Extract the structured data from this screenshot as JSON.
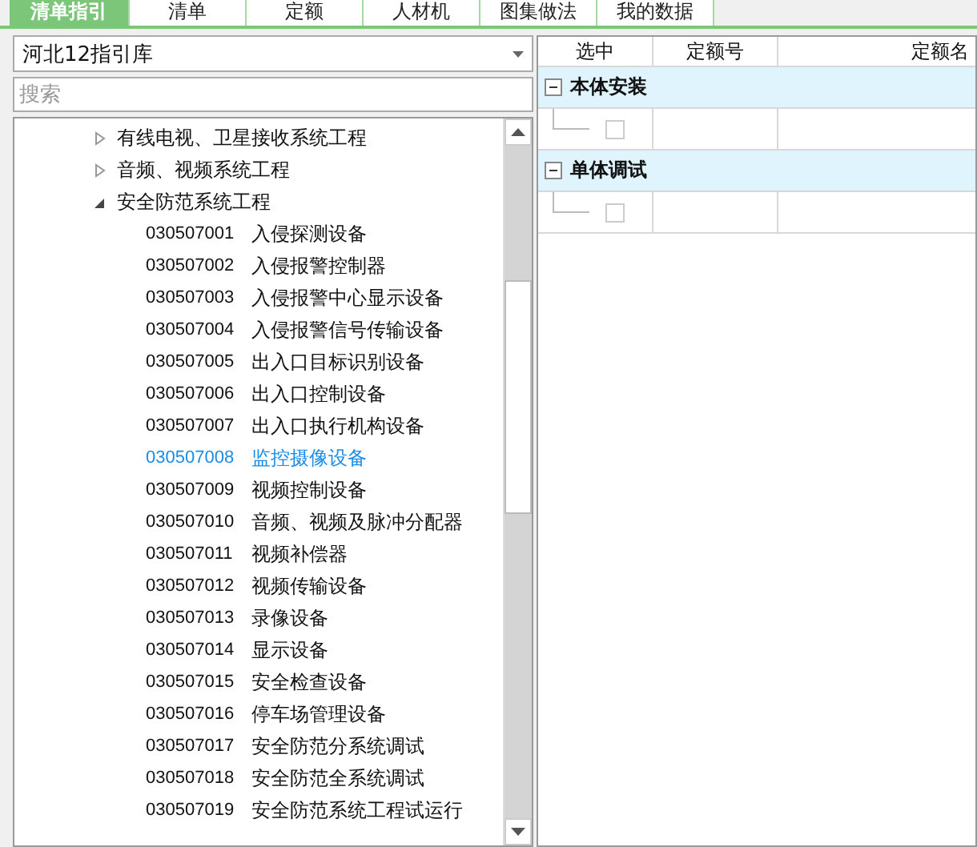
{
  "tabs": [
    {
      "label": "清单指引",
      "selected": true
    },
    {
      "label": "清单",
      "selected": false
    },
    {
      "label": "定额",
      "selected": false
    },
    {
      "label": "人材机",
      "selected": false
    },
    {
      "label": "图集做法",
      "selected": false
    },
    {
      "label": "我的数据",
      "selected": false
    }
  ],
  "library_select": {
    "value": "河北12指引库"
  },
  "search": {
    "placeholder": "搜索"
  },
  "tree": [
    {
      "label": "有线电视、卫星接收系统工程",
      "expanded": false
    },
    {
      "label": "音频、视频系统工程",
      "expanded": false
    },
    {
      "label": "安全防范系统工程",
      "expanded": true,
      "children": [
        {
          "code": "030507001",
          "name": "入侵探测设备",
          "selected": false
        },
        {
          "code": "030507002",
          "name": "入侵报警控制器",
          "selected": false
        },
        {
          "code": "030507003",
          "name": "入侵报警中心显示设备",
          "selected": false
        },
        {
          "code": "030507004",
          "name": "入侵报警信号传输设备",
          "selected": false
        },
        {
          "code": "030507005",
          "name": "出入口目标识别设备",
          "selected": false
        },
        {
          "code": "030507006",
          "name": "出入口控制设备",
          "selected": false
        },
        {
          "code": "030507007",
          "name": "出入口执行机构设备",
          "selected": false
        },
        {
          "code": "030507008",
          "name": "监控摄像设备",
          "selected": true
        },
        {
          "code": "030507009",
          "name": "视频控制设备",
          "selected": false
        },
        {
          "code": "030507010",
          "name": "音频、视频及脉冲分配器",
          "selected": false
        },
        {
          "code": "030507011",
          "name": "视频补偿器",
          "selected": false
        },
        {
          "code": "030507012",
          "name": "视频传输设备",
          "selected": false
        },
        {
          "code": "030507013",
          "name": "录像设备",
          "selected": false
        },
        {
          "code": "030507014",
          "name": "显示设备",
          "selected": false
        },
        {
          "code": "030507015",
          "name": "安全检查设备",
          "selected": false
        },
        {
          "code": "030507016",
          "name": "停车场管理设备",
          "selected": false
        },
        {
          "code": "030507017",
          "name": "安全防范分系统调试",
          "selected": false
        },
        {
          "code": "030507018",
          "name": "安全防范全系统调试",
          "selected": false
        },
        {
          "code": "030507019",
          "name": "安全防范系统工程试运行",
          "selected": false
        }
      ]
    }
  ],
  "grid": {
    "columns": [
      "选中",
      "定额号",
      "定额名"
    ],
    "groups": [
      {
        "title": "本体安装",
        "expanded": true,
        "rows": [
          {
            "checked": false
          }
        ]
      },
      {
        "title": "单体调试",
        "expanded": true,
        "rows": [
          {
            "checked": false
          }
        ]
      }
    ]
  }
}
